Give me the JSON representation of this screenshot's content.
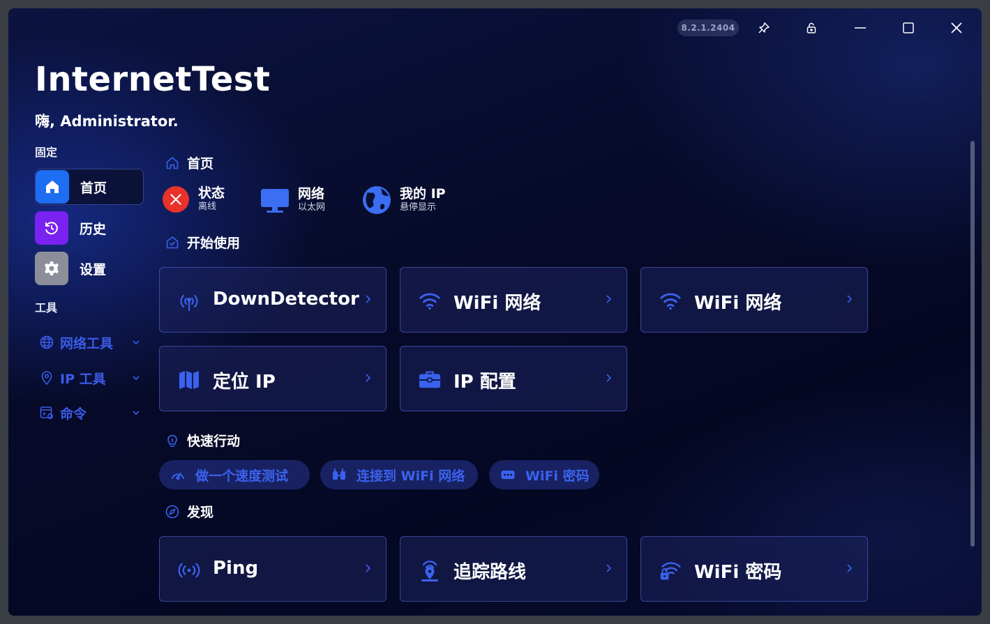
{
  "app": {
    "version": "8.2.1.2404",
    "title": "InternetTest",
    "greeting": "嗨, Administrator."
  },
  "titlebar": {
    "icons": [
      "pin-icon",
      "unlock-icon",
      "minimize-icon",
      "maximize-icon",
      "close-icon"
    ]
  },
  "sidebar": {
    "pinned_header": "固定",
    "items": [
      {
        "label": "首页",
        "icon": "home-icon",
        "color": "#1d6ef2"
      },
      {
        "label": "历史",
        "icon": "history-icon",
        "color": "#7a22f0"
      },
      {
        "label": "设置",
        "icon": "gear-icon",
        "color": "#8c8f99"
      }
    ],
    "tools_header": "工具",
    "tools": [
      {
        "label": "网络工具",
        "icon": "globe-icon"
      },
      {
        "label": "IP 工具",
        "icon": "location-pin-icon"
      },
      {
        "label": "命令",
        "icon": "terminal-icon"
      }
    ]
  },
  "main": {
    "home_header": "首页",
    "status": [
      {
        "title": "状态",
        "subtitle": "离线",
        "icon": "offline-x-icon"
      },
      {
        "title": "网络",
        "subtitle": "以太网",
        "icon": "monitor-icon"
      },
      {
        "title": "我的 IP",
        "subtitle": "悬停显示",
        "icon": "earth-icon"
      }
    ],
    "get_started_header": "开始使用",
    "get_started_cards": [
      {
        "label": "DownDetector",
        "icon": "signal-tower-icon"
      },
      {
        "label": "WiFi 网络",
        "icon": "wifi-icon"
      },
      {
        "label": "WiFi 网络",
        "icon": "wifi-icon"
      },
      {
        "label": "定位 IP",
        "icon": "map-icon"
      },
      {
        "label": "IP 配置",
        "icon": "toolbox-icon"
      }
    ],
    "quick_actions_header": "快速行动",
    "quick_actions": [
      {
        "label": "做一个速度测试",
        "icon": "speedometer-icon"
      },
      {
        "label": "连接到 WiFi 网络",
        "icon": "connect-icon"
      },
      {
        "label": "WiFi 密码",
        "icon": "password-icon"
      }
    ],
    "discover_header": "发现",
    "discover_cards": [
      {
        "label": "Ping",
        "icon": "broadcast-icon"
      },
      {
        "label": "追踪路线",
        "icon": "route-icon"
      },
      {
        "label": "WiFi 密码",
        "icon": "wifi-lock-icon"
      }
    ]
  },
  "colors": {
    "accent": "#3b62ee",
    "offline_red": "#e8322a"
  }
}
